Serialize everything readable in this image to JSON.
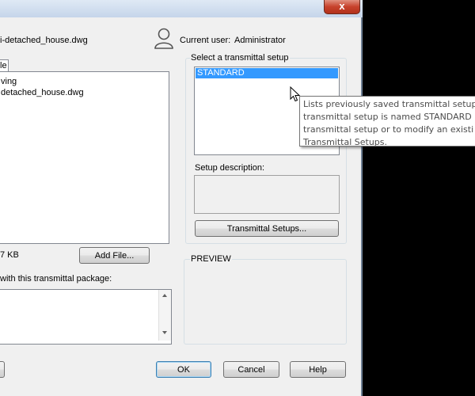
{
  "window": {
    "close_glyph": "x",
    "filename_fragment": "i-detached_house.dwg",
    "current_user_label": "Current user:",
    "current_user_value": "Administrator"
  },
  "files_panel": {
    "tab_label": "le",
    "tree_items": [
      "ving",
      "detached_house.dwg"
    ],
    "size_text": "7 KB",
    "add_file_label": "Add File..."
  },
  "notes": {
    "label": "with this transmittal package:",
    "value": ""
  },
  "setup": {
    "group_label": "Select a transmittal setup",
    "items": [
      "STANDARD"
    ],
    "selected_index": 0,
    "description_label": "Setup description:",
    "description_value": "",
    "setups_button_label": "Transmittal Setups..."
  },
  "preview": {
    "label": "PREVIEW"
  },
  "tooltip": {
    "lines": [
      "Lists previously saved transmittal setup",
      "transmittal setup is named STANDARD",
      "transmittal setup or to modify an existi",
      "Transmittal Setups."
    ]
  },
  "buttons": {
    "ok": "OK",
    "cancel": "Cancel",
    "help": "Help"
  },
  "colors": {
    "selection": "#3399ff",
    "close_button": "#c7422c",
    "dialog_bg": "#f0f0f0"
  },
  "icons": {
    "user": "user-icon",
    "cursor": "mouse-pointer-icon"
  }
}
